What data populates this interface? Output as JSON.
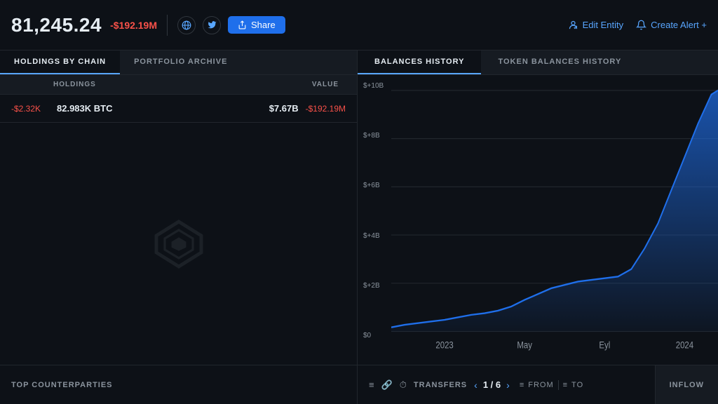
{
  "header": {
    "price": "81,245.24",
    "price_change": "-$192.19M",
    "share_label": "Share",
    "edit_entity_label": "Edit Entity",
    "create_alert_label": "Create Alert +"
  },
  "left_panel": {
    "tab1": "HOLDINGS BY CHAIN",
    "tab2": "PORTFOLIO ARCHIVE",
    "col_holdings": "HOLDINGS",
    "col_value": "VALUE",
    "row": {
      "change": "-$2.32K",
      "holdings": "82.983K BTC",
      "value": "$7.67B",
      "value_change": "-$192.19M"
    },
    "bottom_label": "TOP COUNTERPARTIES"
  },
  "right_panel": {
    "tab1": "BALANCES HISTORY",
    "tab2": "TOKEN BALANCES HISTORY",
    "y_labels": [
      "$+10B",
      "$+8B",
      "$+6B",
      "$+4B",
      "$+2B",
      "$0"
    ],
    "x_labels": [
      "2023",
      "May",
      "Eyl",
      "2024"
    ]
  },
  "transfers": {
    "label": "TRANSFERS",
    "current": "1",
    "total": "6",
    "inflow_label": "INFLOW"
  },
  "filters": {
    "filter1": "TIME",
    "filter2": "FROM",
    "filter3": "TO"
  }
}
